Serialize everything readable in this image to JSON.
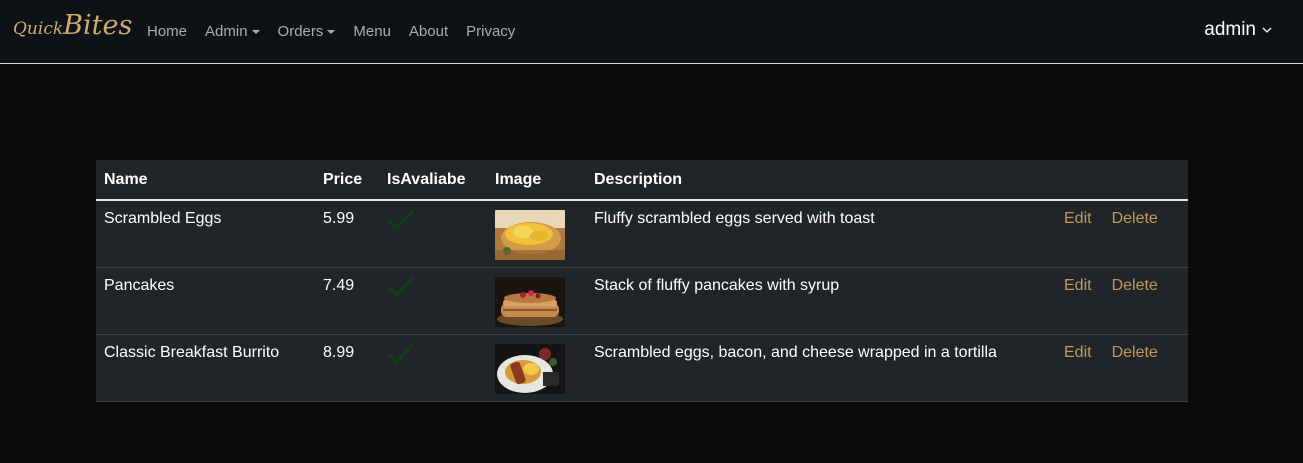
{
  "brand": {
    "part1": "Quick",
    "part2": "Bites",
    "color": "#d3ab6d"
  },
  "nav": {
    "items": [
      {
        "label": "Home",
        "dropdown": false
      },
      {
        "label": "Admin",
        "dropdown": true
      },
      {
        "label": "Orders",
        "dropdown": true
      },
      {
        "label": "Menu",
        "dropdown": false
      },
      {
        "label": "About",
        "dropdown": false
      },
      {
        "label": "Privacy",
        "dropdown": false
      }
    ],
    "user": {
      "label": "admin",
      "icon": "chevron-down-icon"
    }
  },
  "table": {
    "headers": [
      "Name",
      "Price",
      "IsAvaliabe",
      "Image",
      "Description",
      ""
    ],
    "rows": [
      {
        "name": "Scrambled Eggs",
        "price": "5.99",
        "available": true,
        "image": "scrambled-eggs-photo",
        "description": "Fluffy scrambled eggs served with toast",
        "edit": "Edit",
        "delete": "Delete"
      },
      {
        "name": "Pancakes",
        "price": "7.49",
        "available": true,
        "image": "pancakes-photo",
        "description": "Stack of fluffy pancakes with syrup",
        "edit": "Edit",
        "delete": "Delete"
      },
      {
        "name": "Classic Breakfast Burrito",
        "price": "8.99",
        "available": true,
        "image": "breakfast-burrito-photo",
        "description": "Scrambled eggs, bacon, and cheese wrapped in a tortilla",
        "edit": "Edit",
        "delete": "Delete"
      }
    ]
  },
  "colors": {
    "accent": "#c19a5b",
    "check": "#0f3d19",
    "table_bg": "#212529",
    "page_bg": "#0b0b09",
    "nav_bg": "#0c1215"
  }
}
